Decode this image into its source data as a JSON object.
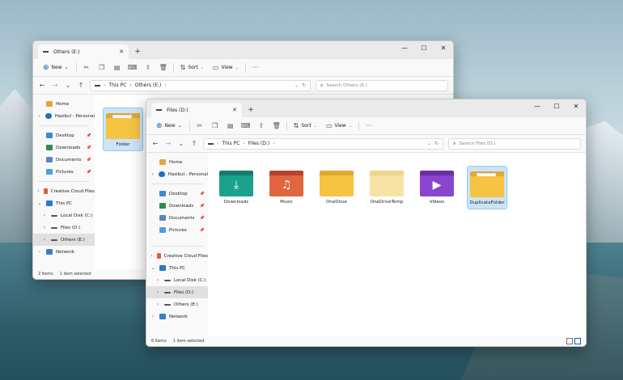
{
  "back_window": {
    "tab_title": "Others (E:)",
    "toolbar": {
      "new": "New",
      "sort": "Sort",
      "view": "View",
      "more": "···"
    },
    "address": {
      "path": [
        "This PC",
        "Others (E:)"
      ]
    },
    "search_placeholder": "Search Others (E:)",
    "nav": {
      "home": "Home",
      "personal": "Hasibul - Personal",
      "quick": [
        {
          "label": "Desktop",
          "icon": "desktop-icon"
        },
        {
          "label": "Downloads",
          "icon": "downloads-icon"
        },
        {
          "label": "Documents",
          "icon": "documents-icon"
        },
        {
          "label": "Pictures",
          "icon": "pictures-icon"
        }
      ],
      "creative": "Creative Cloud Files",
      "this_pc": "This PC",
      "drives": [
        "Local Disk (C:)",
        "Files (D:)",
        "Others (E:)"
      ],
      "network": "Network"
    },
    "items": [
      {
        "label": "Folder"
      }
    ],
    "status": {
      "count": "2 items",
      "selected": "1 item selected"
    }
  },
  "front_window": {
    "tab_title": "Files (D:)",
    "toolbar": {
      "new": "New",
      "sort": "Sort",
      "view": "View",
      "more": "···"
    },
    "address": {
      "path": [
        "This PC",
        "Files (D:)"
      ]
    },
    "search_placeholder": "Search Files (D:)",
    "nav": {
      "home": "Home",
      "personal": "Hasibul - Personal",
      "quick": [
        {
          "label": "Desktop",
          "icon": "desktop-icon"
        },
        {
          "label": "Downloads",
          "icon": "downloads-icon"
        },
        {
          "label": "Documents",
          "icon": "documents-icon"
        },
        {
          "label": "Pictures",
          "icon": "pictures-icon"
        }
      ],
      "creative": "Creative Cloud Files",
      "this_pc": "This PC",
      "drives": [
        "Local Disk (C:)",
        "Files (D:)",
        "Others (E:)"
      ],
      "network": "Network"
    },
    "items": [
      {
        "label": "Downloads",
        "icon": "downloads-folder-icon"
      },
      {
        "label": "Music",
        "icon": "music-folder-icon"
      },
      {
        "label": "OneDrive",
        "icon": "folder-icon"
      },
      {
        "label": "OneDriveTemp",
        "icon": "folder-icon"
      },
      {
        "label": "Videos",
        "icon": "videos-folder-icon"
      },
      {
        "label": "DuplicateFolder",
        "icon": "folder-icon"
      }
    ],
    "status": {
      "count": "6 items",
      "selected": "1 item selected"
    }
  },
  "colors": {
    "accent": "#1b5fb4",
    "folder_yellow": "#f6c343",
    "selection": "#cce4f7"
  }
}
